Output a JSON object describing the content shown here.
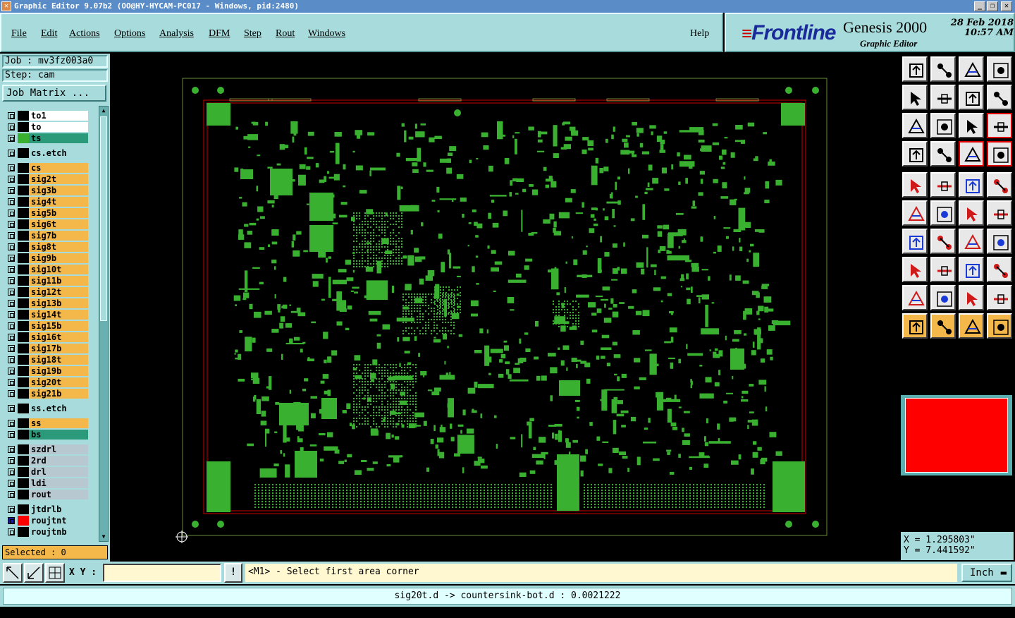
{
  "window": {
    "title": "Graphic Editor 9.07b2 (OO@HY-HYCAM-PC017 - Windows, pid:2480)",
    "controls": [
      "_",
      "❐",
      "✕"
    ]
  },
  "menu": {
    "items": [
      "File",
      "Edit",
      "Actions",
      "Options",
      "Analysis",
      "DFM",
      "Step",
      "Rout",
      "Windows"
    ],
    "help": "Help"
  },
  "brand": {
    "logo": "Frontline",
    "product": "Genesis 2000",
    "subtitle": "Graphic Editor",
    "date": "28 Feb 2018",
    "time": "10:57 AM"
  },
  "job": {
    "job_label": "Job : mv3fz003a0",
    "step_label": "Step: cam",
    "matrix_button": "Job Matrix ..."
  },
  "layers": [
    {
      "name": "to1",
      "color": "#ffffff",
      "swatch": "#000000",
      "group": 0
    },
    {
      "name": "to",
      "color": "#ffffff",
      "swatch": "#000000",
      "group": 0
    },
    {
      "name": "ts",
      "color": "#2a9a7a",
      "swatch": "#3ab030",
      "group": 0
    },
    {
      "name": "cs.etch",
      "color": "#a8dcdc",
      "swatch": "#000000",
      "group": 1
    },
    {
      "name": "cs",
      "color": "#f4b84a",
      "swatch": "#000000",
      "group": 2
    },
    {
      "name": "sig2t",
      "color": "#f4b84a",
      "swatch": "#000000",
      "group": 2
    },
    {
      "name": "sig3b",
      "color": "#f4b84a",
      "swatch": "#000000",
      "group": 2
    },
    {
      "name": "sig4t",
      "color": "#f4b84a",
      "swatch": "#000000",
      "group": 2
    },
    {
      "name": "sig5b",
      "color": "#f4b84a",
      "swatch": "#000000",
      "group": 2
    },
    {
      "name": "sig6t",
      "color": "#f4b84a",
      "swatch": "#000000",
      "group": 2
    },
    {
      "name": "sig7b",
      "color": "#f4b84a",
      "swatch": "#000000",
      "group": 2
    },
    {
      "name": "sig8t",
      "color": "#f4b84a",
      "swatch": "#000000",
      "group": 2
    },
    {
      "name": "sig9b",
      "color": "#f4b84a",
      "swatch": "#000000",
      "group": 2
    },
    {
      "name": "sig10t",
      "color": "#f4b84a",
      "swatch": "#000000",
      "group": 2
    },
    {
      "name": "sig11b",
      "color": "#f4b84a",
      "swatch": "#000000",
      "group": 2
    },
    {
      "name": "sig12t",
      "color": "#f4b84a",
      "swatch": "#000000",
      "group": 2
    },
    {
      "name": "sig13b",
      "color": "#f4b84a",
      "swatch": "#000000",
      "group": 2
    },
    {
      "name": "sig14t",
      "color": "#f4b84a",
      "swatch": "#000000",
      "group": 2
    },
    {
      "name": "sig15b",
      "color": "#f4b84a",
      "swatch": "#000000",
      "group": 2
    },
    {
      "name": "sig16t",
      "color": "#f4b84a",
      "swatch": "#000000",
      "group": 2
    },
    {
      "name": "sig17b",
      "color": "#f4b84a",
      "swatch": "#000000",
      "group": 2
    },
    {
      "name": "sig18t",
      "color": "#f4b84a",
      "swatch": "#000000",
      "group": 2
    },
    {
      "name": "sig19b",
      "color": "#f4b84a",
      "swatch": "#000000",
      "group": 2
    },
    {
      "name": "sig20t",
      "color": "#f4b84a",
      "swatch": "#000000",
      "group": 2
    },
    {
      "name": "sig21b",
      "color": "#f4b84a",
      "swatch": "#000000",
      "group": 2
    },
    {
      "name": "ss.etch",
      "color": "#a8dcdc",
      "swatch": "#000000",
      "group": 3
    },
    {
      "name": "ss",
      "color": "#f4b84a",
      "swatch": "#000000",
      "group": 4
    },
    {
      "name": "bs",
      "color": "#2a9a7a",
      "swatch": "#000000",
      "group": 4
    },
    {
      "name": "szdrl",
      "color": "#b8c8d0",
      "swatch": "#000000",
      "group": 5
    },
    {
      "name": "2rd",
      "color": "#b8c8d0",
      "swatch": "#000000",
      "group": 5
    },
    {
      "name": "drl",
      "color": "#b8c8d0",
      "swatch": "#000000",
      "group": 5
    },
    {
      "name": "ldi",
      "color": "#b8c8d0",
      "swatch": "#000000",
      "group": 5
    },
    {
      "name": "rout",
      "color": "#b8c8d0",
      "swatch": "#000000",
      "group": 5
    },
    {
      "name": "jtdrlb",
      "color": "#a8dcdc",
      "swatch": "#000000",
      "group": 6
    },
    {
      "name": "roujtnt",
      "color": "#a8dcdc",
      "swatch": "#ff0000",
      "group": 6,
      "active": true
    },
    {
      "name": "roujtnb",
      "color": "#a8dcdc",
      "swatch": "#000000",
      "group": 6
    }
  ],
  "selected_label": "Selected : 0",
  "coords": {
    "x": "X = 1.295803\"",
    "y": "Y = 7.441592\""
  },
  "status": {
    "xy_label": "X Y :",
    "xy_value": "",
    "prompt_flag": "!",
    "prompt": "<M1> - Select first area corner",
    "units": "Inch"
  },
  "info_line": "sig20t.d -> countersink-bot.d : 0.0021222",
  "colors": {
    "panel": "#a8dcdc",
    "board_copper": "#3ab030",
    "profile": "#d00000",
    "highlight": "#ff0000"
  },
  "toolbar_icons": [
    "zoom-home-icon",
    "zoom-prev-icon",
    "home-icon",
    "split-view-icon",
    "pan-left-icon",
    "pan-right-icon",
    "flip-icon",
    "redraw-icon",
    "fit-profile-icon",
    "fit-screen-icon",
    "zoom-1to2-icon",
    "query-icon",
    "measure-settings-icon",
    "snap-icon",
    "net-highlight-icon",
    "net-select-icon",
    "add-feature-icon",
    "edit-line-icon",
    "ruler-icon",
    "pad-icon",
    "move-node-icon",
    "delete-node-icon",
    "add-node-icon",
    "split-node-icon",
    "angle-icon",
    "line-icon",
    "arc-icon",
    "resize-icon",
    "add-pad-icon",
    "cut-line-icon",
    "measure-distance-icon",
    "copy-features-icon",
    "polygon-icon",
    "polygon-edit-icon",
    "polygon-fill-icon",
    "polygon-cut-icon",
    "select-pointer-icon",
    "select-box-icon",
    "select-area-icon",
    "select-net-icon"
  ]
}
